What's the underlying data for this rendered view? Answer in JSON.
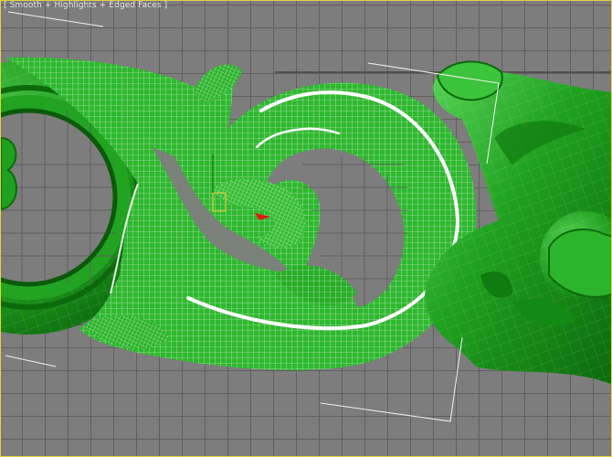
{
  "viewport": {
    "label": "[ Smooth + Highlights + Edged Faces ]",
    "name": "perspective-viewport",
    "shading_mode": "Smooth + Highlights + Edged Faces",
    "colors": {
      "background": "#7d7d7d",
      "grid": "#5f5f5f",
      "active_border": "#e8d23a",
      "model_fill": "#1fa01f",
      "model_dark": "#0c6a0c",
      "model_light": "#4fd04f",
      "wire": "#ffffff",
      "guide_lines": "#f2f2f2"
    }
  }
}
